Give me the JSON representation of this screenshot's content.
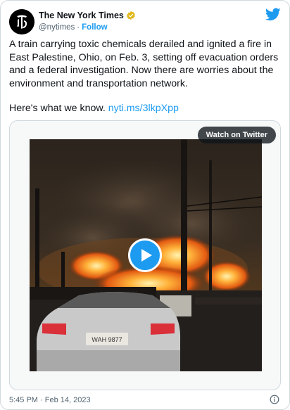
{
  "author": {
    "display_name": "The New York Times",
    "handle": "@nytimes",
    "separator": "·",
    "follow_label": "Follow",
    "avatar_icon": "nyt-logo-icon",
    "verified_icon": "verified-badge-icon",
    "verified_color": "#e2b719"
  },
  "tweet": {
    "text": "A train carrying toxic chemicals derailed and ignited a fire in East Palestine, Ohio, on Feb. 3, setting off evacuation orders and a federal investigation. Now there are worries about the environment and transportation network.",
    "cta_text": "Here's what we know.",
    "link": "nyti.ms/3lkpXpp",
    "link_color": "#1d9bf0"
  },
  "media": {
    "watch_label": "Watch on Twitter",
    "play_icon": "play-icon",
    "license_plate": "WAH 9877"
  },
  "footer": {
    "timestamp": "5:45 PM · Feb 14, 2023",
    "info_icon": "info-icon"
  },
  "brand": {
    "twitter_icon": "twitter-bird-icon",
    "twitter_color": "#1d9bf0"
  }
}
